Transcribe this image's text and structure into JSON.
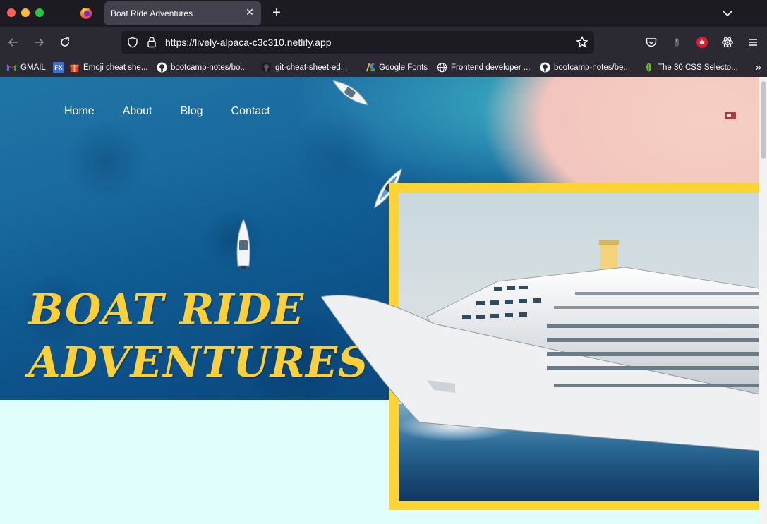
{
  "browser": {
    "tab_title": "Boat Ride Adventures",
    "tab_close": "✕",
    "new_tab": "+",
    "url": "https://lively-alpaca-c3c310.netlify.app",
    "bookmarks": [
      {
        "label": "GMAIL",
        "icon": "gmail-icon"
      },
      {
        "label": "Emoji cheat she...",
        "icon": "gift-icon"
      },
      {
        "label": "bootcamp-notes/bo...",
        "icon": "github-icon"
      },
      {
        "label": "git-cheat-sheet-ed...",
        "icon": "github-icon"
      },
      {
        "label": "Google Fonts",
        "icon": "google-fonts-icon"
      },
      {
        "label": "Frontend developer ...",
        "icon": "globe-icon"
      },
      {
        "label": "bootcamp-notes/be...",
        "icon": "github-icon"
      },
      {
        "label": "The 30 CSS Selecto...",
        "icon": "leaf-icon"
      }
    ],
    "fx_badge": "FX",
    "more": "»"
  },
  "site": {
    "nav": [
      "Home",
      "About",
      "Blog",
      "Contact"
    ],
    "hero_title_line1": "Boat Ride",
    "hero_title_line2": "Adventures",
    "colors": {
      "accent": "#fdd434",
      "page_background": "#e0fffc",
      "hero_text": "#fdd03a"
    }
  }
}
